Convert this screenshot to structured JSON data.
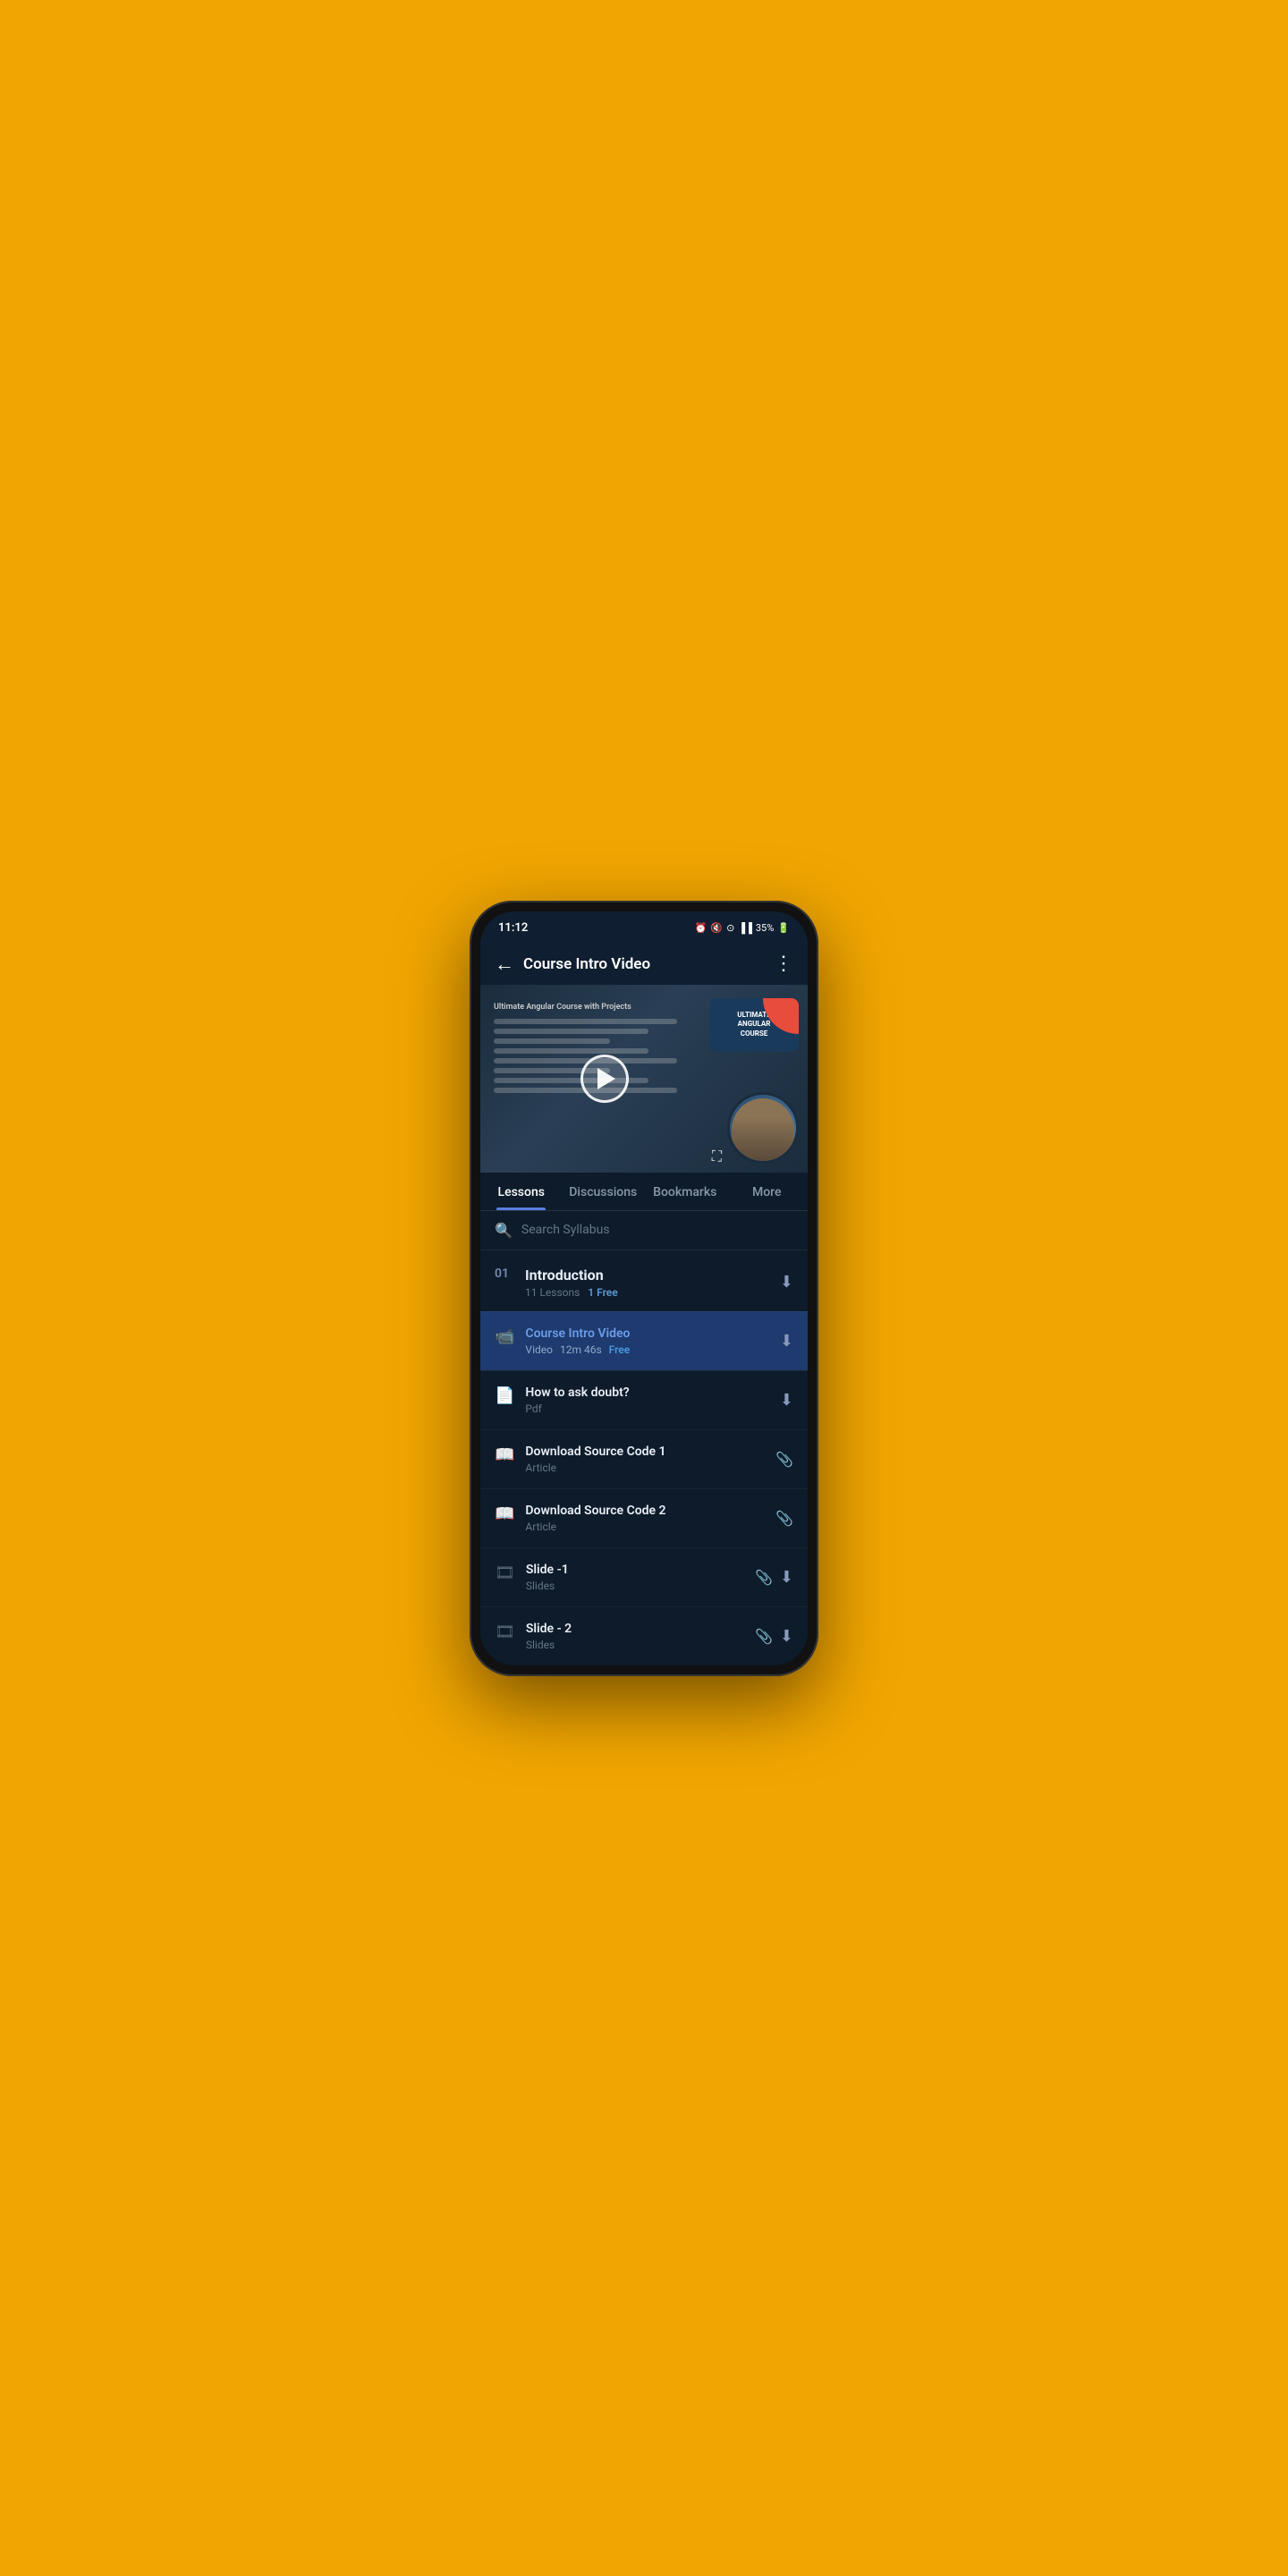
{
  "statusBar": {
    "time": "11:12",
    "battery": "35%",
    "signal": "●●●●",
    "wifi": "wifi"
  },
  "header": {
    "title": "Course Intro Video",
    "backLabel": "←",
    "menuLabel": "⋮"
  },
  "tabs": [
    {
      "id": "lessons",
      "label": "Lessons",
      "active": true
    },
    {
      "id": "discussions",
      "label": "Discussions",
      "active": false
    },
    {
      "id": "bookmarks",
      "label": "Bookmarks",
      "active": false
    },
    {
      "id": "more",
      "label": "More",
      "active": false
    }
  ],
  "search": {
    "placeholder": "Search Syllabus"
  },
  "section": {
    "number": "01",
    "title": "Introduction",
    "lessonsCount": "11 Lessons",
    "freeCount": "1 Free"
  },
  "lessons": [
    {
      "id": 1,
      "type": "video",
      "title": "Course Intro Video",
      "subtitle": "Video",
      "duration": "12m 46s",
      "free": true,
      "active": true,
      "hasDownload": true,
      "hasClip": false
    },
    {
      "id": 2,
      "type": "pdf",
      "title": "How to ask doubt?",
      "subtitle": "Pdf",
      "duration": "",
      "free": false,
      "active": false,
      "hasDownload": true,
      "hasClip": false
    },
    {
      "id": 3,
      "type": "article",
      "title": "Download Source Code 1",
      "subtitle": "Article",
      "duration": "",
      "free": false,
      "active": false,
      "hasDownload": false,
      "hasClip": true
    },
    {
      "id": 4,
      "type": "article",
      "title": "Download Source Code 2",
      "subtitle": "Article",
      "duration": "",
      "free": false,
      "active": false,
      "hasDownload": false,
      "hasClip": true
    },
    {
      "id": 5,
      "type": "slides",
      "title": "Slide -1",
      "subtitle": "Slides",
      "duration": "",
      "free": false,
      "active": false,
      "hasDownload": true,
      "hasClip": true
    },
    {
      "id": 6,
      "type": "slides",
      "title": "Slide  - 2",
      "subtitle": "Slides",
      "duration": "",
      "free": false,
      "active": false,
      "hasDownload": true,
      "hasClip": true
    }
  ],
  "icons": {
    "video": "📹",
    "pdf": "📄",
    "article": "📖",
    "slides": "🎞",
    "download": "⬇",
    "clip": "📎",
    "search": "🔍",
    "back": "←",
    "menu": "⋮",
    "play": "▶",
    "fullscreen": "⛶"
  }
}
